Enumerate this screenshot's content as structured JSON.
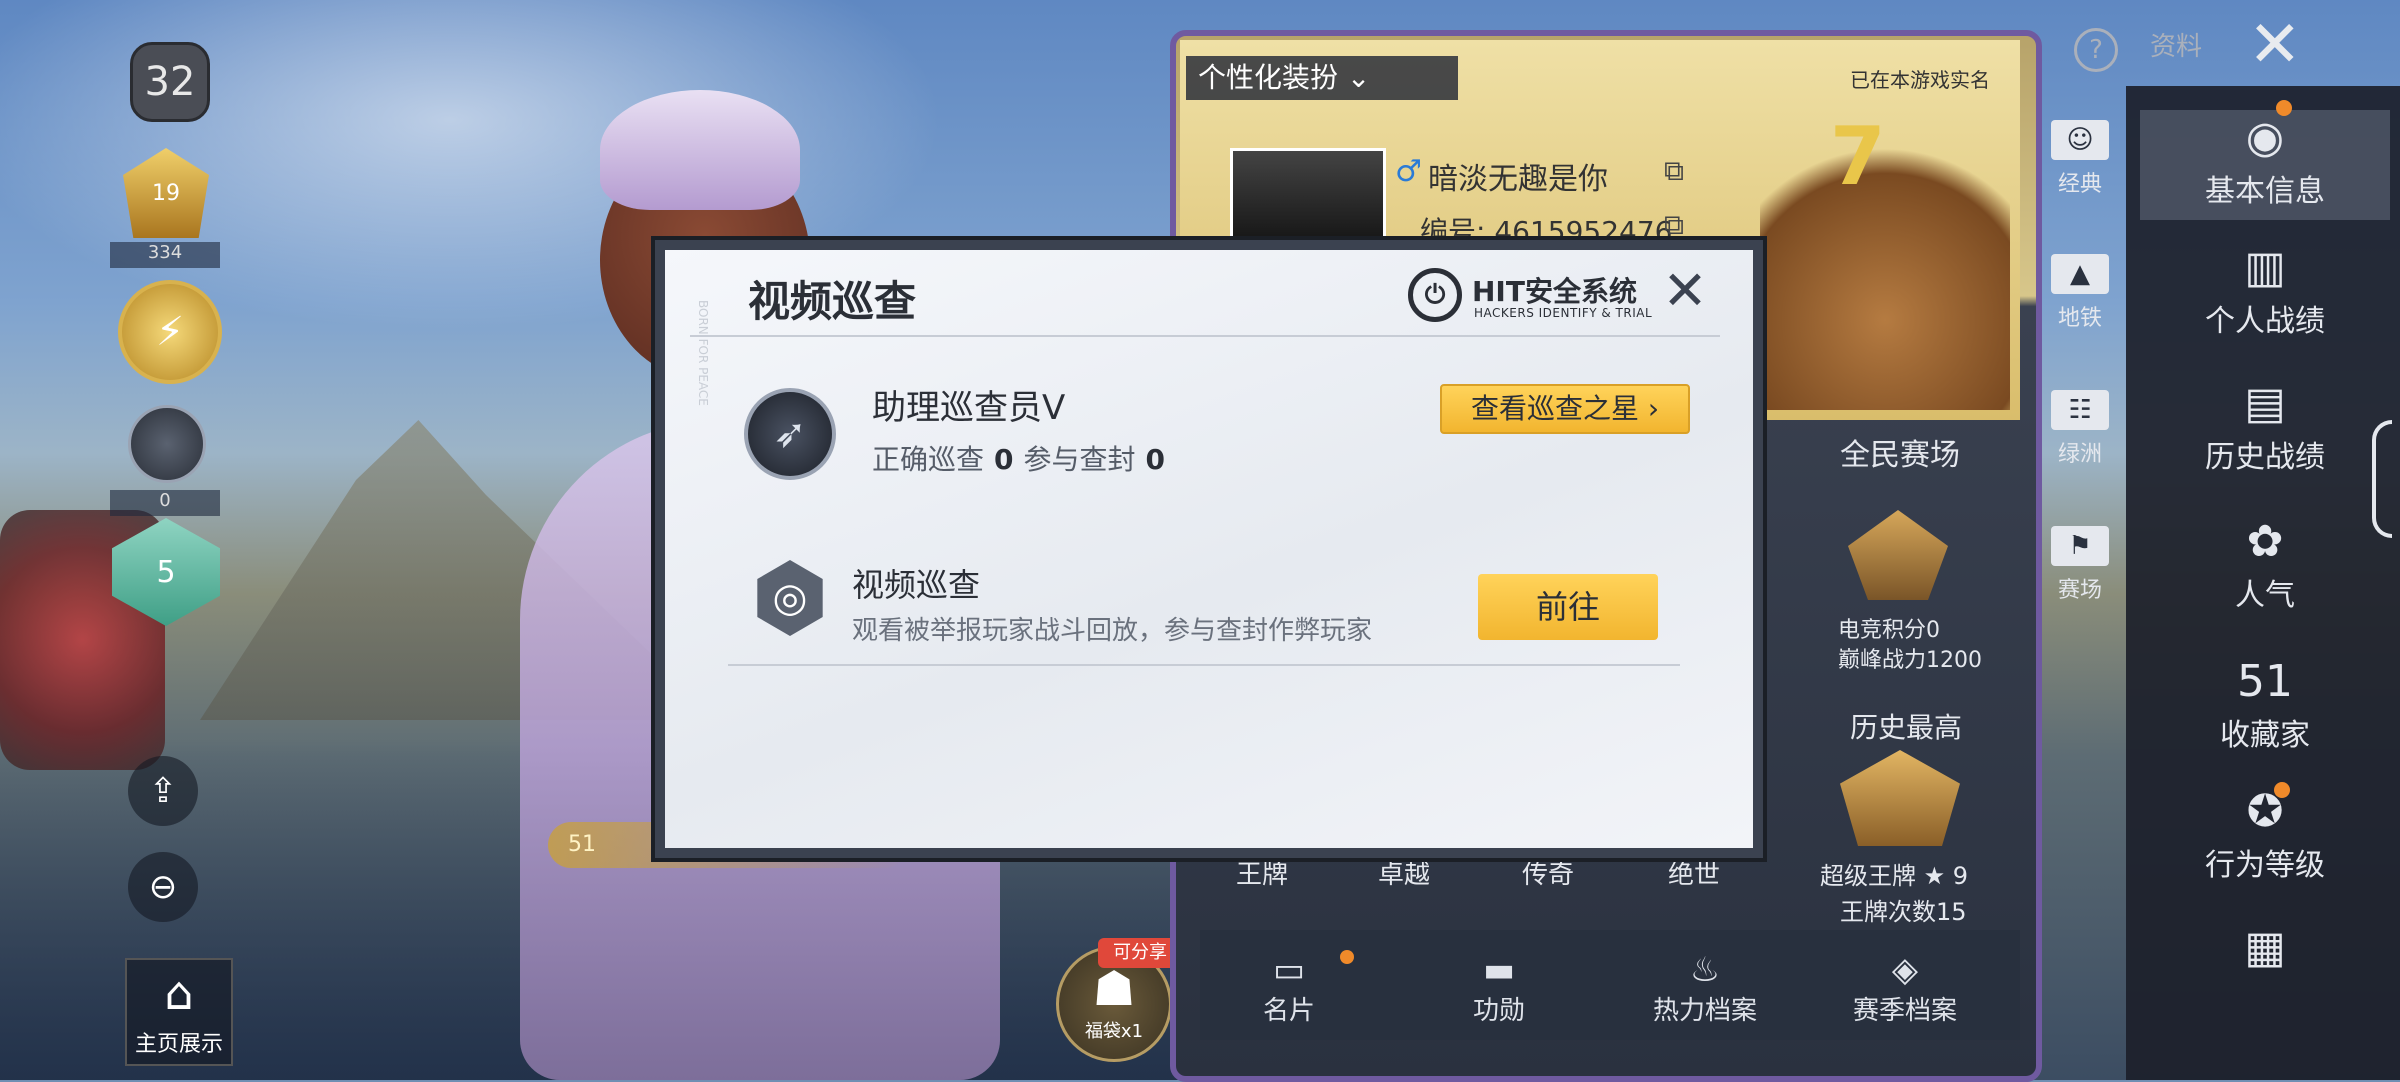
{
  "hud": {
    "level": "32",
    "rank1_value": "19",
    "rank1_points": "334",
    "rank3_points": "0",
    "rank4_level": "5",
    "home_display_label": "主页展示",
    "gift_label": "福袋x1",
    "gift_tag": "可分享",
    "char_tag_level": "51"
  },
  "profile": {
    "custom_dress_label": "个性化装扮",
    "realname_label": "已在本游戏实名",
    "player_name": "暗淡无趣是你",
    "player_id": "编号: 4615952476",
    "cake_number": "7",
    "quanmin_label": "全民赛场",
    "esport_points": "电竞积分0",
    "peak_power": "巅峰战力1200",
    "history_high": "历史最高",
    "super_ace": "超级王牌 ★ 9",
    "ace_count": "王牌次数15",
    "tiers": [
      "王牌",
      "卓越",
      "传奇",
      "绝世"
    ],
    "bottom_tabs": [
      "名片",
      "功勋",
      "热力档案",
      "赛季档案"
    ]
  },
  "modal": {
    "title": "视频巡查",
    "hit_logo_text": "HIT安全系统",
    "hit_logo_sub": "HACKERS IDENTIFY & TRIAL",
    "inspector_title": "助理巡查员V",
    "correct_label": "正确巡查",
    "correct_value": "0",
    "joined_label": "参与查封",
    "joined_value": "0",
    "star_button": "查看巡查之星",
    "patrol_title": "视频巡查",
    "patrol_desc": "观看被举报玩家战斗回放，参与查封作弊玩家",
    "go_button": "前往",
    "watermark": "BORN FOR PEACE"
  },
  "sidebar": {
    "top_label": "资料",
    "modes": [
      "经典",
      "地铁",
      "绿洲",
      "赛场"
    ],
    "items": [
      "基本信息",
      "个人战绩",
      "历史战绩",
      "人气",
      "收藏家",
      "行为等级"
    ],
    "collector_badge": "51"
  },
  "colors": {
    "accent_yellow": "#f2b52f",
    "notify_orange": "#f08a2a",
    "gift_red": "#e0483a",
    "modal_border": "#3b4250"
  },
  "icons": [
    "share-icon",
    "zoom-out-icon",
    "home-icon",
    "edit-icon",
    "gift-icon",
    "copy-icon",
    "help-icon",
    "close-icon",
    "target-icon",
    "rifle-badge-icon",
    "user-card-icon",
    "chart-icon",
    "document-icon",
    "popularity-icon",
    "collector-icon",
    "behavior-icon",
    "notes-icon"
  ]
}
